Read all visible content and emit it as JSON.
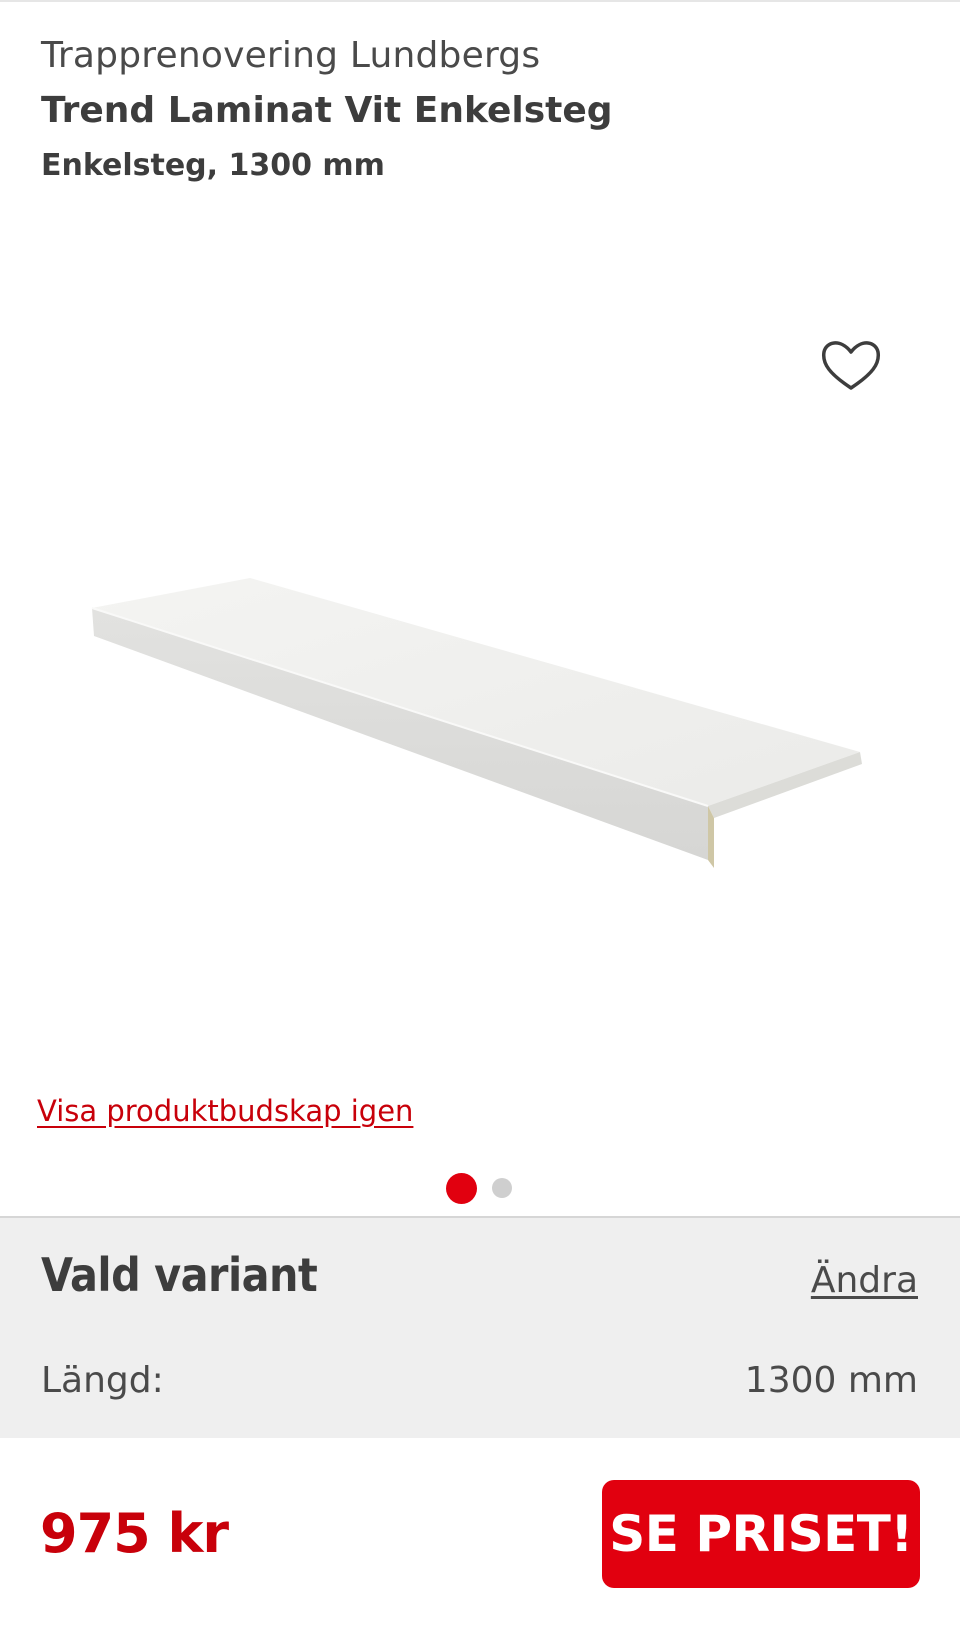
{
  "product": {
    "brand": "Trapprenovering Lundbergs",
    "title": "Trend Laminat Vit Enkelsteg",
    "subtitle": "Enkelsteg, 1300 mm"
  },
  "gallery": {
    "favorite_icon": "heart-outline-icon",
    "show_message_link": "Visa produktbudskap igen",
    "slide_count": 2,
    "active_slide": 1
  },
  "variant": {
    "heading": "Vald variant",
    "change_link": "Ändra",
    "attribute_label": "Längd:",
    "attribute_value": "1300 mm"
  },
  "purchase": {
    "price": "975 kr",
    "cta_label": "SE PRISET!"
  },
  "colors": {
    "accent": "#e1000f",
    "price": "#c8000a",
    "text": "#3d3d3d",
    "panel": "#efefef"
  }
}
